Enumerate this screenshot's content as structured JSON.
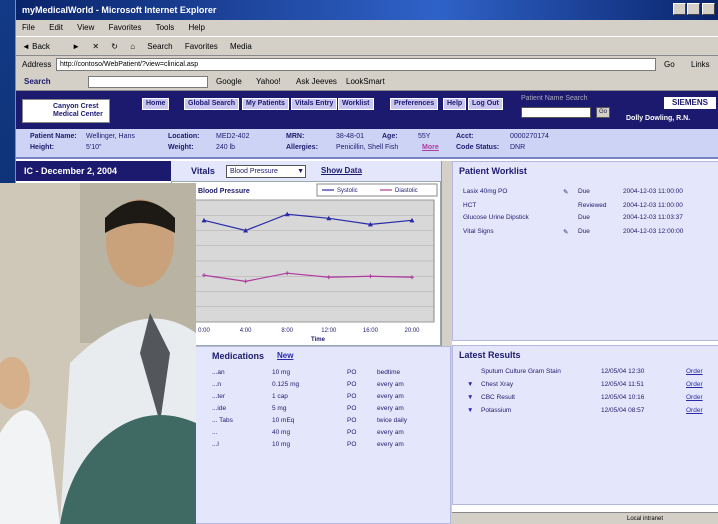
{
  "browser": {
    "title": "myMedicalWorld - Microsoft Internet Explorer",
    "menu": [
      "File",
      "Edit",
      "View",
      "Favorites",
      "Tools",
      "Help"
    ],
    "toolbar": [
      "Back",
      "Search",
      "Favorites",
      "Media"
    ],
    "address_label": "Address",
    "address_value": "http://contoso/WebPatient/?view=clinical.asp",
    "go_label": "Go",
    "links_label": "Links",
    "search_label": "Search",
    "search_toolbar_items": [
      "Google",
      "Yahoo!",
      "Ask Jeeves",
      "LookSmart"
    ],
    "status_text": "Local intranet"
  },
  "app": {
    "logo_text": "Canyon Crest Medical Center",
    "nav": [
      "Home",
      "Global Search",
      "My Patients",
      "Vitals Entry",
      "Worklist",
      "Preferences",
      "Help",
      "Log Out"
    ],
    "patient_search_label": "Patient Name Search",
    "patient_search_go": "Go",
    "brand": "SIEMENS",
    "user": "Dolly Dowling, R.N."
  },
  "patient": {
    "name_label": "Patient Name:",
    "name": "Wellinger, Hans",
    "location_label": "Location:",
    "location": "MED2-402",
    "mrn_label": "MRN:",
    "mrn": "38-48-01",
    "age_label": "Age:",
    "age": "55Y",
    "acct_label": "Acct:",
    "acct": "0000270174",
    "height_label": "Height:",
    "height": "5'10\"",
    "weight_label": "Weight:",
    "weight": "240 lb",
    "allergies_label": "Allergies:",
    "allergies": "Penicillin, Shell Fish",
    "allergies_more": "More",
    "code_label": "Code Status:",
    "code": "DNR"
  },
  "date_header": "IC - December 2, 2004",
  "vitals": {
    "label": "Vitals",
    "selected": "Blood Pressure",
    "show_data": "Show Data"
  },
  "chart_data": {
    "type": "line",
    "title": "Blood Pressure",
    "xlabel": "Time",
    "categories": [
      "0:00",
      "4:00",
      "8:00",
      "12:00",
      "16:00",
      "20:00"
    ],
    "series": [
      {
        "name": "Systolic",
        "values": [
          140,
          130,
          146,
          142,
          136,
          140
        ],
        "color": "#2a2aa8"
      },
      {
        "name": "Diastolic",
        "values": [
          86,
          80,
          88,
          84,
          85,
          84
        ],
        "color": "#b03aa0"
      }
    ],
    "yticks": [
      "",
      "",
      "",
      "",
      "",
      "",
      "",
      "",
      ""
    ],
    "ylim": [
      40,
      160
    ],
    "grid": true,
    "legend": "top-right"
  },
  "meds": {
    "title": "Medications",
    "new_link": "New",
    "rows": [
      {
        "drug": "...an",
        "dose": "10 mg",
        "route": "PO",
        "freq": "bedtime"
      },
      {
        "drug": "...n",
        "dose": "0.125 mg",
        "route": "PO",
        "freq": "every am"
      },
      {
        "drug": "...ter",
        "dose": "1 cap",
        "route": "PO",
        "freq": "every am"
      },
      {
        "drug": "...ide",
        "dose": "5 mg",
        "route": "PO",
        "freq": "every am"
      },
      {
        "drug": "... Tabs",
        "dose": "10 mEq",
        "route": "PO",
        "freq": "twice daily"
      },
      {
        "drug": "...",
        "dose": "40 mg",
        "route": "PO",
        "freq": "every am"
      },
      {
        "drug": "...l",
        "dose": "10 mg",
        "route": "PO",
        "freq": "every am"
      }
    ]
  },
  "worklist": {
    "title": "Patient Worklist",
    "rows": [
      {
        "task": "Lasix 40mg PO",
        "status": "Due",
        "time": "2004-12-03 11:00:00"
      },
      {
        "task": "HCT",
        "status": "Reviewed",
        "time": "2004-12-03 11:00:00"
      },
      {
        "task": "Glucose Urine Dipstick",
        "status": "Due",
        "time": "2004-12-03 11:03:37"
      },
      {
        "task": "Vital Signs",
        "status": "Due",
        "time": "2004-12-03 12:00:00"
      }
    ]
  },
  "results": {
    "title": "Latest Results",
    "rows": [
      {
        "name": "Sputum Culture Gram Stain",
        "time": "12/05/04 12:30",
        "order": "Order"
      },
      {
        "name": "Chest Xray",
        "time": "12/05/04 11:51",
        "order": "Order"
      },
      {
        "name": "CBC Result",
        "time": "12/05/04 10:16",
        "order": "Order"
      },
      {
        "name": "Potassium",
        "time": "12/05/04 08:57",
        "order": "Order"
      }
    ]
  }
}
